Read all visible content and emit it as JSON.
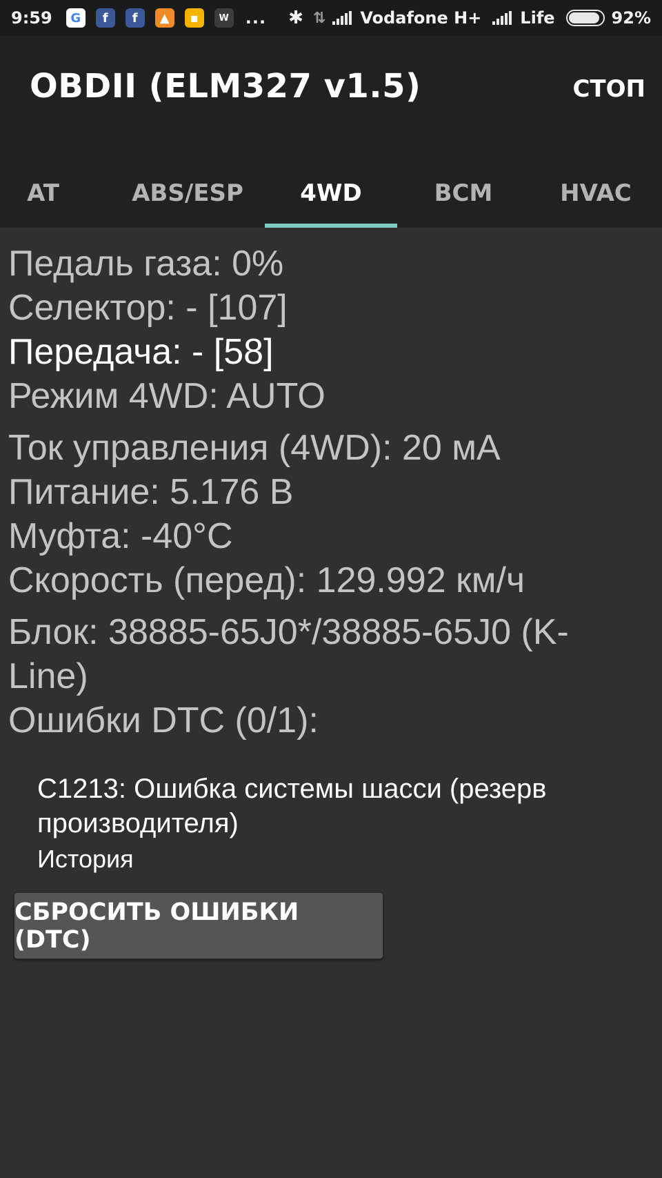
{
  "status_bar": {
    "time": "9:59",
    "notification_icons": [
      "google-icon",
      "facebook-icon",
      "facebook-icon",
      "strava-icon",
      "keep-notes-icon",
      "word-app-icon"
    ],
    "more": "...",
    "carrier1": "Vodafone H+",
    "carrier2": "Life",
    "battery_percent": "92%",
    "battery_level": 0.92
  },
  "app_bar": {
    "title": "OBDII (ELM327 v1.5)",
    "stop_label": "СТОП"
  },
  "tabs": [
    {
      "label": "AT",
      "active": false
    },
    {
      "label": "ABS/ESP",
      "active": false
    },
    {
      "label": "4WD",
      "active": true
    },
    {
      "label": "BCM",
      "active": false
    },
    {
      "label": "HVAC",
      "active": false
    }
  ],
  "readings": {
    "throttle": "Педаль газа: 0%",
    "selector": "Селектор: - [107]",
    "gear": "Передача: - [58]",
    "mode_4wd": "Режим 4WD: AUTO",
    "control_current": "Ток управления (4WD): 20 мА",
    "power": "Питание: 5.176 В",
    "clutch": "Муфта: -40°C",
    "speed_front": "Скорость (перед): 129.992 км/ч",
    "block": "Блок: 38885-65J0*/38885-65J0 (K-Line)",
    "dtc_header": "Ошибки DTC (0/1):"
  },
  "dtc_list": [
    {
      "text": "C1213: Ошибка системы шасси (резерв производителя)",
      "status": "История"
    }
  ],
  "reset_button_label": "СБРОСИТЬ ОШИБКИ (DTC)"
}
